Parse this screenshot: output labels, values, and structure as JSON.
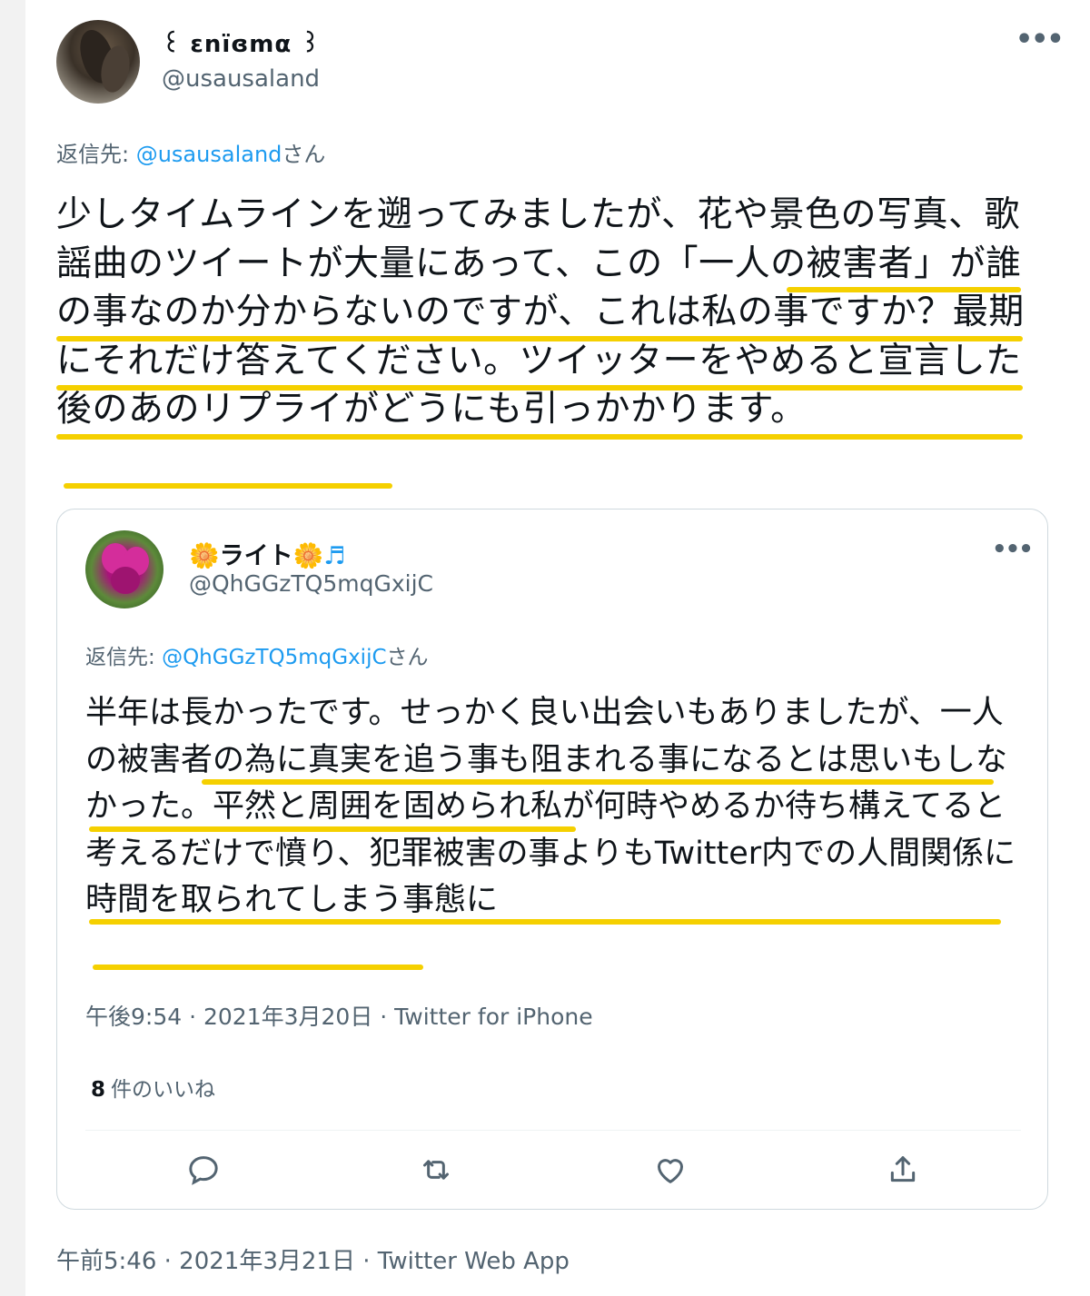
{
  "main_tweet": {
    "display_name": "꒰ εnïɞmα ꒱",
    "handle": "@usausaland",
    "more_label": "•••",
    "reply_prefix": "返信先: ",
    "reply_mention": "@usausaland",
    "reply_suffix": "さん",
    "text": "少しタイムラインを遡ってみましたが、花や景色の写真、歌謡曲のツイートが大量にあって、この「一人の被害者」が誰の事なのか分からないのですが、これは私の事ですか？最期にそれだけ答えてください。ツイッターをやめると宣言した後のあのリプライがどうにも引っかかります。",
    "meta": "午前5:46 · 2021年3月21日 · Twitter Web App"
  },
  "quoted_tweet": {
    "display_name_prefix": "🌼",
    "display_name": "ライト",
    "display_name_suffix": "🌼",
    "notes": "♬",
    "handle": "@QhGGzTQ5mqGxijC",
    "more_label": "•••",
    "reply_prefix": "返信先: ",
    "reply_mention": "@QhGGzTQ5mqGxijC",
    "reply_suffix": "さん",
    "text": "半年は長かったです。せっかく良い出会いもありましたが、一人の被害者の為に真実を追う事も阻まれる事になるとは思いもしなかった。平然と周囲を固められ私が何時やめるか待ち構えてると考えるだけで憤り、犯罪被害の事よりもTwitter内での人間関係に時間を取られてしまう事態に",
    "meta": "午後9:54 · 2021年3月20日 · Twitter for iPhone",
    "likes_count": "8",
    "likes_label": "件のいいね",
    "actions": [
      "reply-icon",
      "retweet-icon",
      "like-icon",
      "share-icon"
    ]
  },
  "colors": {
    "highlight": "#f5d000",
    "link": "#1d9bf0",
    "secondary_text": "#536471"
  }
}
